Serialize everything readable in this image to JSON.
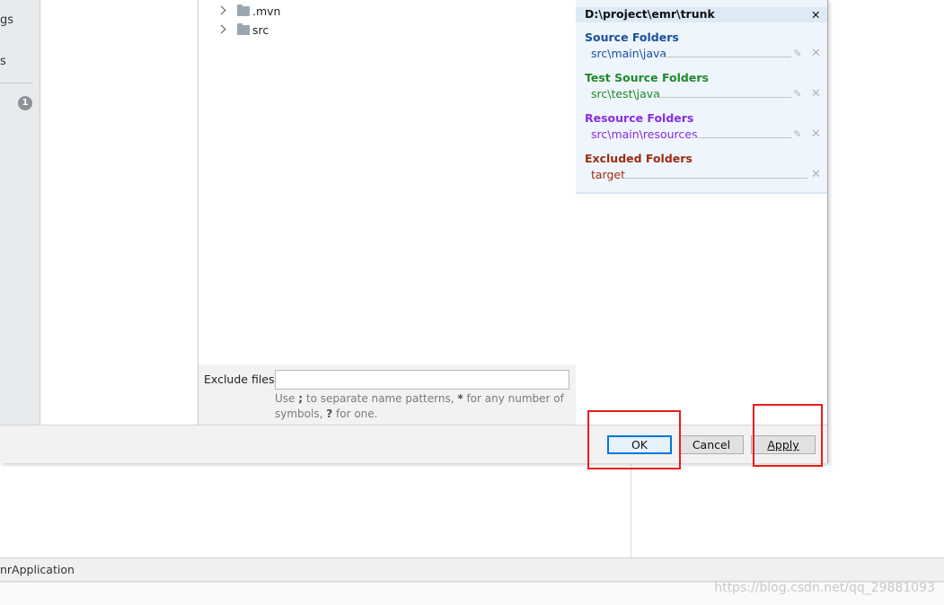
{
  "background": {
    "status_text": "nrApplication",
    "watermark": "https://blog.csdn.net/qq_29881093"
  },
  "left_strip": {
    "item1": "gs",
    "item2": "s",
    "badge": "1"
  },
  "tree": {
    "items": [
      {
        "name": ".mvn",
        "icon": "folder-icon"
      },
      {
        "name": "src",
        "icon": "folder-icon"
      }
    ]
  },
  "exclude": {
    "label": "Exclude files:",
    "value": "",
    "hint_part1": "Use ",
    "hint_sep": ";",
    "hint_part2": " to separate name patterns, ",
    "hint_star": "*",
    "hint_part3": " for any number of symbols, ",
    "hint_q": "?",
    "hint_part4": " for one."
  },
  "content_root": {
    "path": "D:\\project\\emr\\trunk",
    "groups": [
      {
        "title": "Source Folders",
        "path": "src\\main\\java",
        "color": "#1a4fa0"
      },
      {
        "title": "Test Source Folders",
        "path": "src\\test\\java",
        "color": "#1f8a2b"
      },
      {
        "title": "Resource Folders",
        "path": "src\\main\\resources",
        "color": "#8a2be2"
      },
      {
        "title": "Excluded Folders",
        "path": "target",
        "color": "#9b2d0f"
      }
    ]
  },
  "buttons": {
    "ok": "OK",
    "cancel": "Cancel",
    "apply": "Apply"
  },
  "colors": {
    "annotation_red": "#ee1c1c",
    "ok_focus": "#0078d7"
  }
}
